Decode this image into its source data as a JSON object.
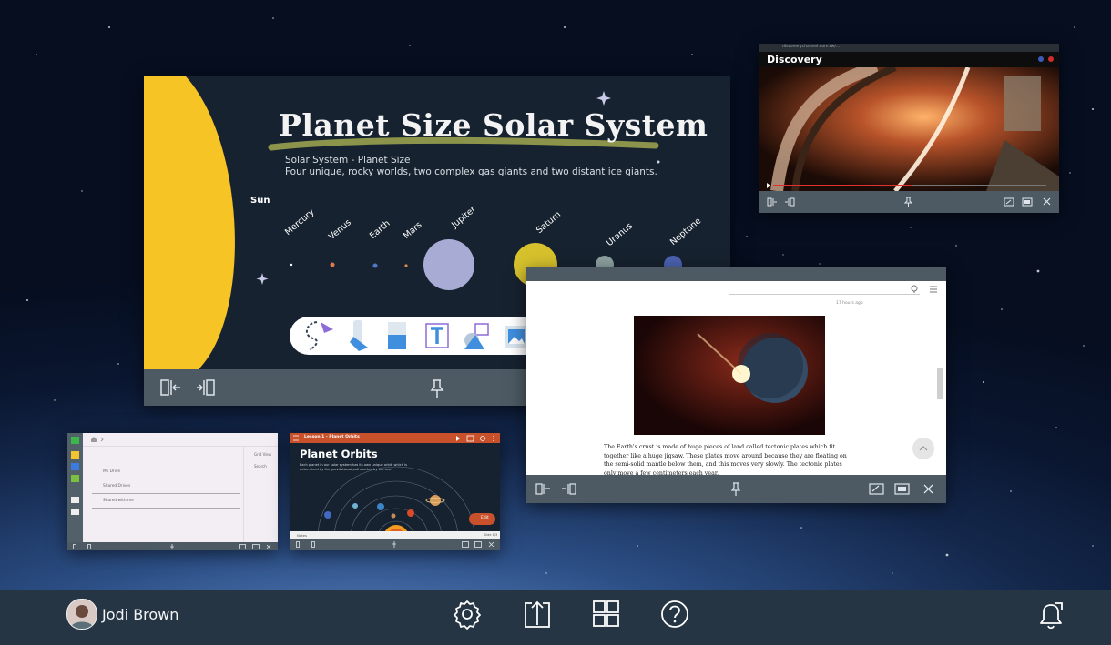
{
  "main_window": {
    "title": "Planet Size Solar System",
    "subtitle": "Solar System - Planet Size",
    "description": "Four unique, rocky worlds, two complex gas giants and two distant ice giants.",
    "sun_label": "Sun",
    "planets": [
      "Mercury",
      "Venus",
      "Earth",
      "Mars",
      "Jupiter",
      "Saturn",
      "Uranus",
      "Neptune"
    ],
    "planet_colors": [
      "#ffffff",
      "#e07a4a",
      "#4f78c8",
      "#d98a4a",
      "#a8acd4",
      "#d7c22d",
      "#8fa3a3",
      "#4d63b3"
    ],
    "tools": [
      "select-tool-icon",
      "pen-tool-icon",
      "eraser-tool-icon",
      "text-tool-icon",
      "shapes-tool-icon",
      "image-tool-icon",
      "toolbox-icon"
    ]
  },
  "discovery_window": {
    "url": "discoverychannel.com.tw/...",
    "brand": "Discovery"
  },
  "article_window": {
    "timestamp": "17 hours ago",
    "body": "The Earth's crust is made of huge pieces of land called tectonic plates which fit together like a huge jigsaw. These plates move around because they are floating on the semi-solid mantle below them, and this moves very slowly. The tectonic plates only move a few centimeters each year."
  },
  "drive_window": {
    "items": [
      "My Drive",
      "Shared Drives",
      "Shared with me"
    ],
    "side": [
      "Grid View",
      "Search"
    ]
  },
  "orbits_window": {
    "header": "Lesson 1 - Planet Orbits",
    "title": "Planet Orbits",
    "desc": "Each planet in our solar system has its own unique orbit, which is determined by the gravitational pull exerted by the sun.",
    "edit_label": "Edit",
    "notes_label": "Notes",
    "slide_label": "Slide 1/3"
  },
  "taskbar": {
    "user_name": "Jodi Brown"
  },
  "colors": {
    "bar": "#4d5a63",
    "taskbar": "#263543",
    "sun": "#f7c425"
  }
}
